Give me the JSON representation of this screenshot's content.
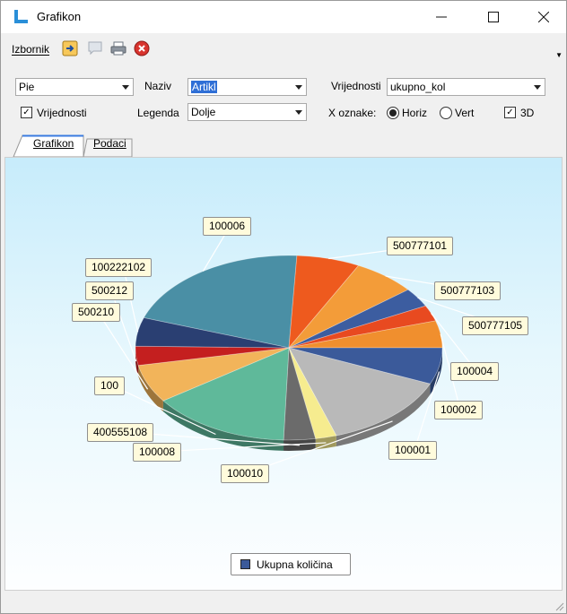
{
  "window": {
    "title": "Grafikon"
  },
  "menu": {
    "label": "Izbornik"
  },
  "controls": {
    "chart_type": "Pie",
    "naziv_label": "Naziv",
    "naziv_value": "Artikl",
    "vrijednosti_label": "Vrijednosti",
    "vrijednosti_value": "ukupno_kol",
    "show_values_label": "Vrijednosti",
    "show_values_checked": true,
    "legenda_label": "Legenda",
    "legenda_value": "Dolje",
    "x_oznake_label": "X oznake:",
    "horiz_label": "Horiz",
    "vert_label": "Vert",
    "orientation_selected": "Horiz",
    "d3_label": "3D",
    "d3_checked": true
  },
  "tabs": [
    {
      "label": "Grafikon",
      "active": true
    },
    {
      "label": "Podaci",
      "active": false
    }
  ],
  "chart_data": {
    "type": "pie",
    "is_3d": true,
    "legend_placement": "bottom",
    "series": [
      {
        "name": "Ukupna količina"
      }
    ],
    "slices": [
      {
        "label": "100006",
        "color": "#4a8fa5"
      },
      {
        "label": "500777101",
        "color": "#ee5a1e"
      },
      {
        "label": "500777103",
        "color": "#f39c39"
      },
      {
        "label": "500777105",
        "color": "#3c5da0"
      },
      {
        "label": "100004",
        "color": "#e84a20"
      },
      {
        "label": "100002",
        "color": "#f08f2e"
      },
      {
        "label": "100001",
        "color": "#3b5a9a"
      },
      {
        "label": "100010",
        "color": "#b9b9b9"
      },
      {
        "label": "100008",
        "color": "#f6ec8f"
      },
      {
        "label": "400555108",
        "color": "#6b6b6b"
      },
      {
        "label": "100",
        "color": "#5fb99a"
      },
      {
        "label": "500210",
        "color": "#f2b45a"
      },
      {
        "label": "500212",
        "color": "#c41f1f"
      },
      {
        "label": "100222102",
        "color": "#2a3f72"
      }
    ]
  }
}
